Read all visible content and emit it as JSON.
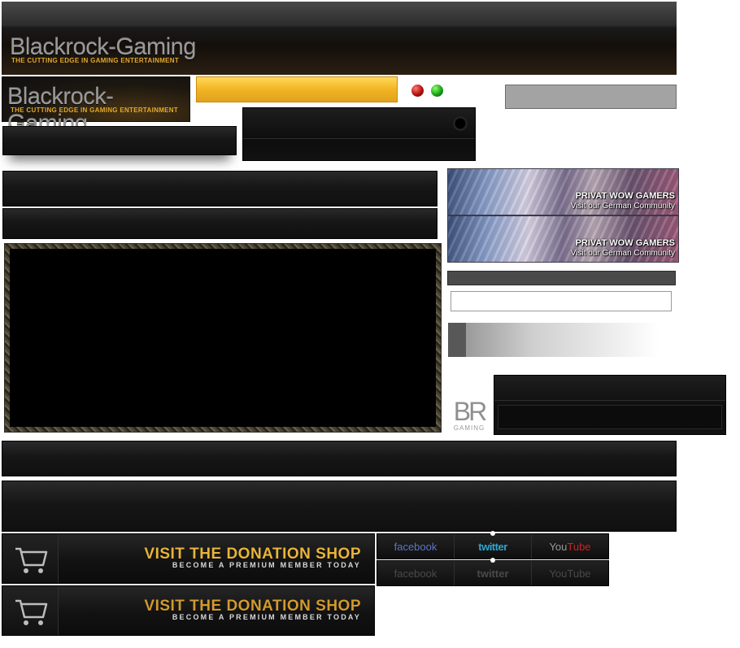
{
  "header": {
    "logo_title": "Blackrock-Gaming",
    "logo_tagline": "THE CUTTING EDGE IN GAMING ENTERTAINMENT"
  },
  "small_logo": {
    "title": "Blackrock-Gaming",
    "tagline": "THE CUTTING EDGE IN GAMING ENTERTAINMENT"
  },
  "banners": [
    {
      "title": "PRIVAT WOW GAMERS",
      "subtitle": "Visit our German Community"
    },
    {
      "title": "PRIVAT WOW GAMERS",
      "subtitle": "Visit our German Community"
    }
  ],
  "br_logo": {
    "letters": "BR",
    "caption": "GAMING"
  },
  "donation": [
    {
      "title": "VISIT THE DONATION SHOP",
      "subtitle": "BECOME A PREMIUM MEMBER TODAY"
    },
    {
      "title": "VISIT THE DONATION SHOP",
      "subtitle": "BECOME A PREMIUM MEMBER TODAY"
    }
  ],
  "social": {
    "active": {
      "facebook": "facebook",
      "twitter": "twitter",
      "you": "You",
      "tube": "Tube"
    },
    "inactive": {
      "facebook": "facebook",
      "twitter": "twitter",
      "you": "You",
      "tube": "Tube"
    }
  },
  "colors": {
    "accent_gold": "#e8b43a",
    "facebook_blue": "#5b76c6",
    "twitter_blue": "#2fa6cf",
    "youtube_red": "#cc2222",
    "status_red": "#b31010",
    "status_green": "#17a117"
  }
}
